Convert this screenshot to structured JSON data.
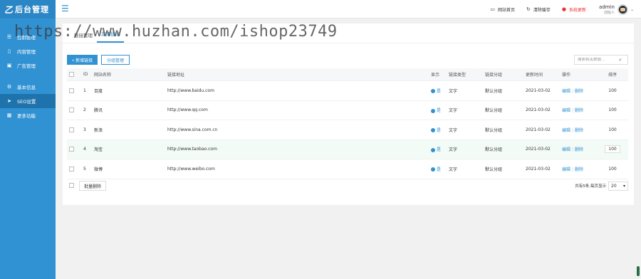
{
  "app": {
    "logo_mark": "乙",
    "logo_text": "后台管理"
  },
  "sidebar": {
    "items": [
      {
        "label": "控制管理",
        "icon": "menu-icon"
      },
      {
        "label": "内容管理",
        "icon": "document-icon"
      },
      {
        "label": "广告管理",
        "icon": "image-icon"
      },
      {
        "label": "基本信息",
        "icon": "gear-icon"
      },
      {
        "label": "SEO设置",
        "icon": "send-icon"
      },
      {
        "label": "更多功能",
        "icon": "grid-icon"
      }
    ],
    "active_index": 4
  },
  "topbar": {
    "actions": [
      {
        "label": "网站首页",
        "icon": "monitor-icon"
      },
      {
        "label": "清除缓存",
        "icon": "refresh-icon"
      },
      {
        "label": "系统更新",
        "icon": "alert-icon"
      }
    ],
    "user": {
      "name": "admin",
      "role": "创始人"
    }
  },
  "tabs": [
    {
      "label": "链接管理"
    },
    {
      "label": "友情链接"
    }
  ],
  "toolbar": {
    "add_label": "+ 新增链接",
    "group_label": "分组管理",
    "search_placeholder": "搜索相关数据..."
  },
  "table": {
    "headers": [
      "ID",
      "网站名称",
      "链接地址",
      "显示",
      "链接类型",
      "链接分组",
      "更新时间",
      "操作",
      "排序"
    ],
    "rows": [
      {
        "id": "1",
        "name": "百度",
        "url": "http://www.baidu.com",
        "show": "是",
        "type": "文字",
        "group": "默认分组",
        "time": "2021-03-02",
        "edit": "编辑",
        "del": "删除",
        "sort": "100"
      },
      {
        "id": "2",
        "name": "腾讯",
        "url": "http://www.qq.com",
        "show": "是",
        "type": "文字",
        "group": "默认分组",
        "time": "2021-03-02",
        "edit": "编辑",
        "del": "删除",
        "sort": "100"
      },
      {
        "id": "3",
        "name": "新浪",
        "url": "http://www.sina.com.cn",
        "show": "是",
        "type": "文字",
        "group": "默认分组",
        "time": "2021-03-02",
        "edit": "编辑",
        "del": "删除",
        "sort": "100"
      },
      {
        "id": "4",
        "name": "淘宝",
        "url": "http://www.taobao.com",
        "show": "是",
        "type": "文字",
        "group": "默认分组",
        "time": "2021-03-02",
        "edit": "编辑",
        "del": "删除",
        "sort": "100"
      },
      {
        "id": "5",
        "name": "微博",
        "url": "http://www.weibo.com",
        "show": "是",
        "type": "文字",
        "group": "默认分组",
        "time": "2021-03-02",
        "edit": "编辑",
        "del": "删除",
        "sort": "100"
      }
    ],
    "highlight_row": 3
  },
  "footer": {
    "batch_delete": "批量删除",
    "total_text": "共有5条,每页显示",
    "page_size": "20"
  },
  "watermark": "https://www.huzhan.com/ishop23749",
  "colors": {
    "primary": "#3192d3",
    "sidebar": "#3192d3",
    "danger": "#ee3333"
  }
}
